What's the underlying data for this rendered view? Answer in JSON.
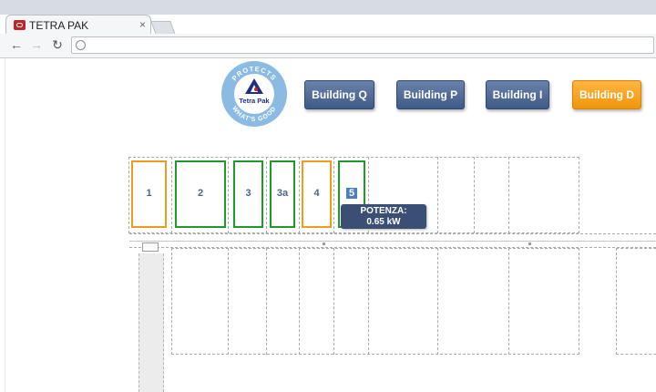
{
  "browser": {
    "tab_title": "TETRA PAK",
    "tab_close": "×",
    "back": "←",
    "forward": "→",
    "reload": "↻"
  },
  "logo": {
    "top_text": "PROTECTS",
    "bottom_text": "WHAT'S GOOD",
    "brand": "Tetra Pak"
  },
  "buildings": [
    {
      "label": "Building Q",
      "active": false
    },
    {
      "label": "Building P",
      "active": false
    },
    {
      "label": "Building I",
      "active": false
    },
    {
      "label": "Building D",
      "active": true
    }
  ],
  "rooms": [
    {
      "label": "1",
      "status": "orange"
    },
    {
      "label": "2",
      "status": "green"
    },
    {
      "label": "3",
      "status": "green"
    },
    {
      "label": "3a",
      "status": "green"
    },
    {
      "label": "4",
      "status": "orange"
    },
    {
      "label": "5",
      "status": "green",
      "selected": true
    }
  ],
  "tooltip": {
    "title": "POTENZA:",
    "value": "0.65 kW"
  },
  "colors": {
    "button_blue": "#4a6491",
    "button_active": "#f7a21b",
    "room_orange": "#f29a1c",
    "room_green": "#1f9a24",
    "tooltip_bg": "#3a4f73"
  }
}
